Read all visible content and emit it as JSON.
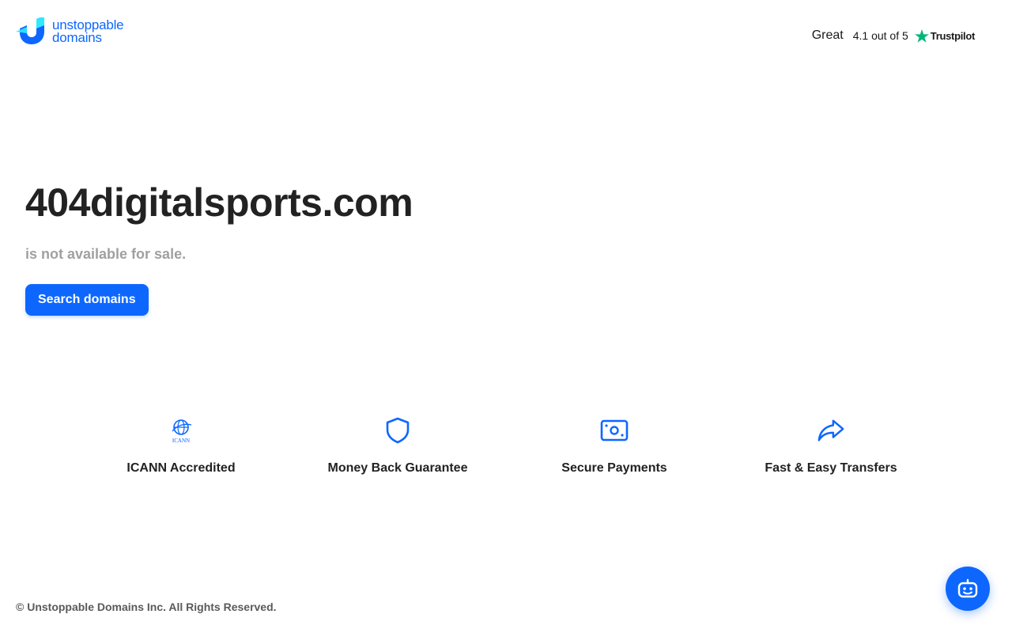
{
  "brand": {
    "line1": "unstoppable",
    "line2": "domains",
    "accent_color": "#0d67fe"
  },
  "trustpilot": {
    "rating_word": "Great",
    "score_text": "4.1 out of 5",
    "brand_name": "Trustpilot",
    "star_color": "#00b67a"
  },
  "hero": {
    "domain": "404digitalsports.com",
    "status": "is not available for sale.",
    "button_label": "Search domains"
  },
  "features": [
    {
      "icon": "icann-icon",
      "label": "ICANN Accredited",
      "icon_text": "ICANN"
    },
    {
      "icon": "shield-icon",
      "label": "Money Back Guarantee"
    },
    {
      "icon": "payment-card-icon",
      "label": "Secure Payments"
    },
    {
      "icon": "share-arrow-icon",
      "label": "Fast & Easy Transfers"
    }
  ],
  "footer": {
    "copyright": "© Unstoppable Domains Inc. All Rights Reserved."
  },
  "chat": {
    "icon": "chatbot-icon"
  }
}
